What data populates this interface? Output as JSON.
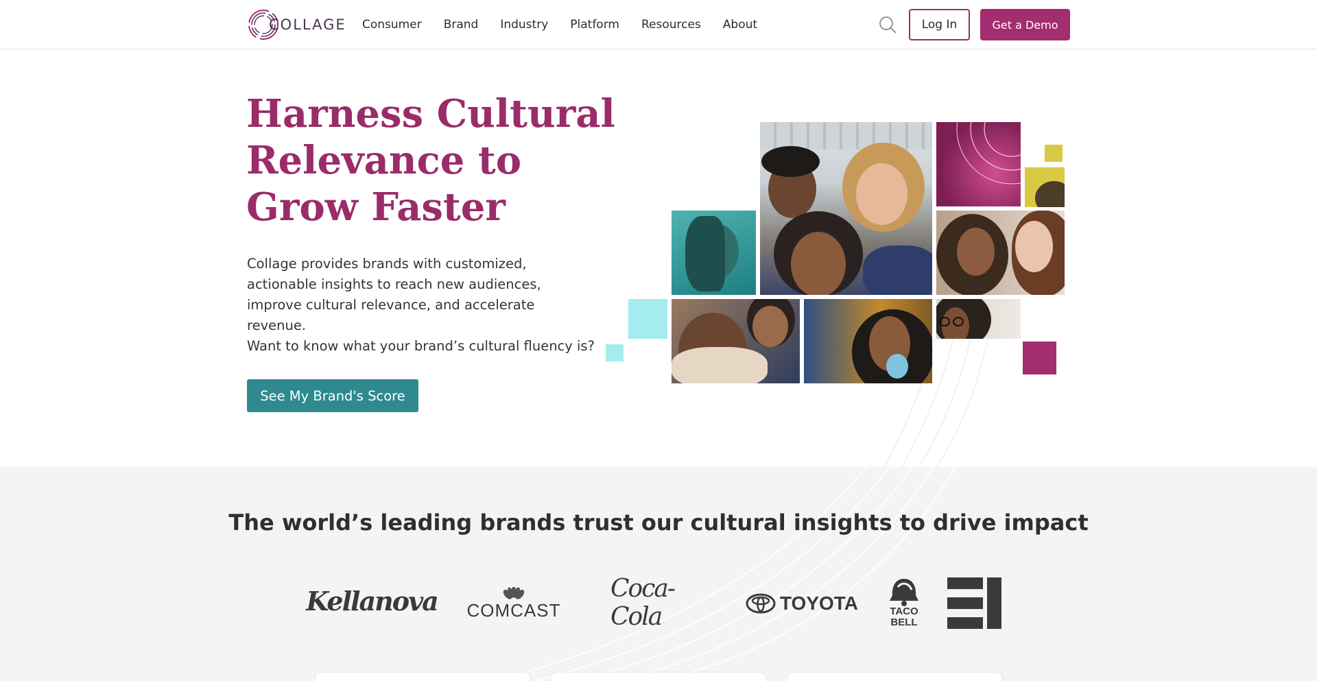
{
  "header": {
    "logo_text": "COLLAGE",
    "nav": [
      "Consumer",
      "Brand",
      "Industry",
      "Platform",
      "Resources",
      "About"
    ],
    "login_label": "Log In",
    "demo_label": "Get a Demo"
  },
  "hero": {
    "title": "Harness Cultural Relevance to Grow Faster",
    "description": "Collage provides brands with customized, actionable insights to reach new audiences, improve cultural relevance, and accelerate revenue.",
    "question": "Want to know what your brand’s cultural fluency is?",
    "cta_label": "See My Brand's Score"
  },
  "trust": {
    "title": "The world’s leading brands trust our cultural insights to drive impact",
    "brands": [
      "Kellanova",
      "COMCAST",
      "Coca-Cola",
      "TOYOTA",
      "TACO BELL",
      "E!"
    ]
  },
  "colors": {
    "brand_magenta": "#a22d6f",
    "teal": "#2e8a8e",
    "light_cyan": "#a5ecee",
    "mustard": "#d9c843",
    "band_gray": "#f3f4f5"
  },
  "icons": [
    "collage-logo-icon",
    "search-icon",
    "cbs-peacock-icon",
    "toyota-emblem-icon",
    "taco-bell-bell-icon"
  ]
}
